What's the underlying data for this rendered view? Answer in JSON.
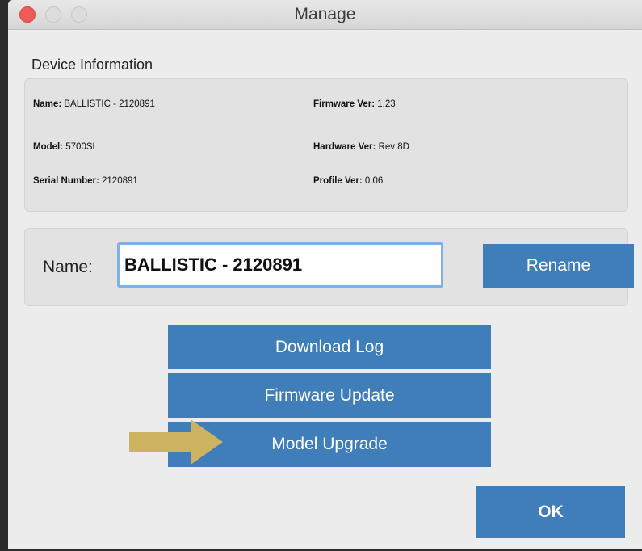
{
  "window": {
    "title": "Manage"
  },
  "device_info": {
    "section_label": "Device Information",
    "name": {
      "label": "Name:",
      "value": "BALLISTIC - 2120891"
    },
    "model": {
      "label": "Model:",
      "value": "5700SL"
    },
    "serial": {
      "label": "Serial Number:",
      "value": "2120891"
    },
    "firmware": {
      "label": "Firmware Ver:",
      "value": "1.23"
    },
    "hardware": {
      "label": "Hardware Ver:",
      "value": "Rev 8D"
    },
    "profile": {
      "label": "Profile Ver:",
      "value": "0.06"
    }
  },
  "rename": {
    "label": "Name:",
    "input_value": "BALLISTIC - 2120891",
    "button_label": "Rename"
  },
  "actions": {
    "download_log": "Download Log",
    "firmware_update": "Firmware Update",
    "model_upgrade": "Model Upgrade"
  },
  "ok_label": "OK",
  "colors": {
    "button_blue": "#3f7eb8",
    "arrow_gold": "#cdb361",
    "close_red": "#ee5b58",
    "input_focus": "#7fb0ea"
  },
  "icons": {
    "arrow": "right-arrow-icon"
  }
}
